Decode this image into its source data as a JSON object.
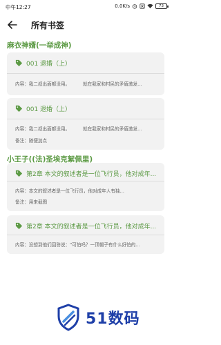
{
  "status_bar": {
    "time": "中午12:27",
    "network_speed": "0.0K/s",
    "battery": "73"
  },
  "header": {
    "title": "所有书签"
  },
  "books": [
    {
      "title": "麻衣神婿(一举成神)",
      "bookmarks": [
        {
          "chapter": "001 退婚（上）",
          "content": "内容：我二叔出面都没用。         就在我家和村民的矛盾激发...",
          "note": ""
        },
        {
          "chapter": "001 退婚（上）",
          "content": "内容：我二叔出面都没用。         就在我家和村民的矛盾激发...",
          "note": "备注：随便加点"
        }
      ]
    },
    {
      "title": "小王子((法)圣埃克絮佩里)",
      "bookmarks": [
        {
          "chapter": "第2章 本文的叙述者是一位飞行员，他对成年...",
          "content": "内容：本文的叙述者是一位飞行员，他对成年人有独...",
          "note": "备注：用来截图"
        },
        {
          "chapter": "第2章 本文的叙述者是一位飞行员，他对成年...",
          "content": "内容：没想到他们回答说：\"可怕吗？一顶帽子有什么好怕的...",
          "note": ""
        }
      ]
    }
  ],
  "watermark": {
    "text": "51数码"
  },
  "colors": {
    "accent": "#5c9a44",
    "card_bg": "#f2f2f2",
    "watermark": "#1e3fa8"
  }
}
